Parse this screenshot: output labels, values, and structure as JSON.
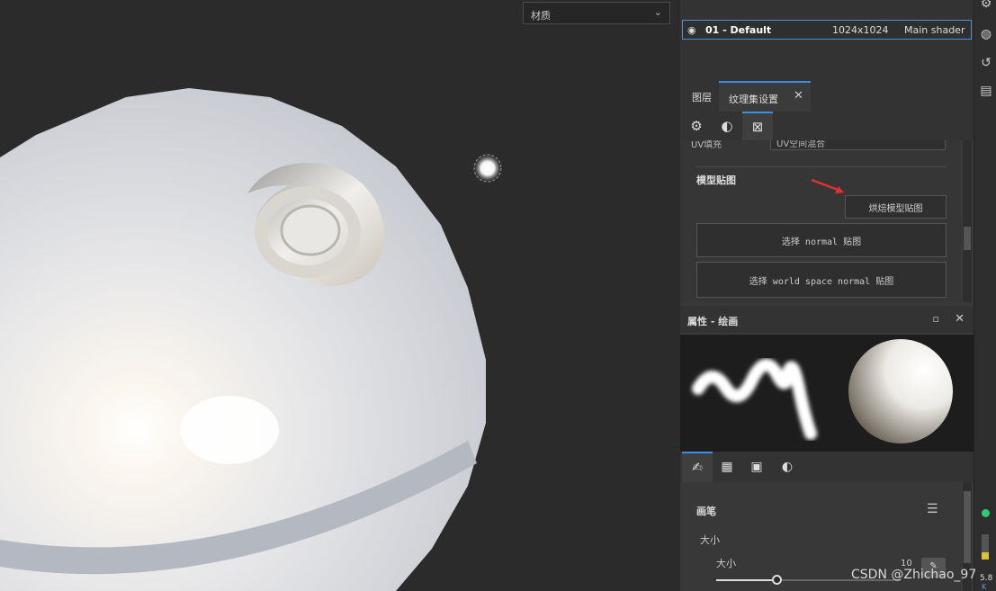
{
  "viewport": {
    "material_select": "材质"
  },
  "texture_set": {
    "row_name": "01 - Default",
    "row_size": "1024x1024",
    "row_shader": "Main shader"
  },
  "tabs": [
    {
      "label": "图层"
    },
    {
      "label": "纹理集设置"
    }
  ],
  "panel": {
    "partial_label": "UV填充",
    "partial_value": "UV空间混合",
    "section_title": "模型贴图",
    "bake_button": "烘焙模型贴图",
    "select_normal": "选择 normal 贴图",
    "select_world_normal": "选择 world space normal 贴图"
  },
  "properties": {
    "title": "属性 - 绘画"
  },
  "brush": {
    "section_title": "画笔",
    "size_label": "大小",
    "size_sub_label": "大小",
    "size_value": "10"
  },
  "watermark": "CSDN @Zhichao_97",
  "far_right": {
    "value_text": "5.8",
    "small_text": "K"
  },
  "colors": {
    "accent": "#3a8ee6",
    "arrow": "#e03030",
    "status_green": "#2ecc71"
  }
}
